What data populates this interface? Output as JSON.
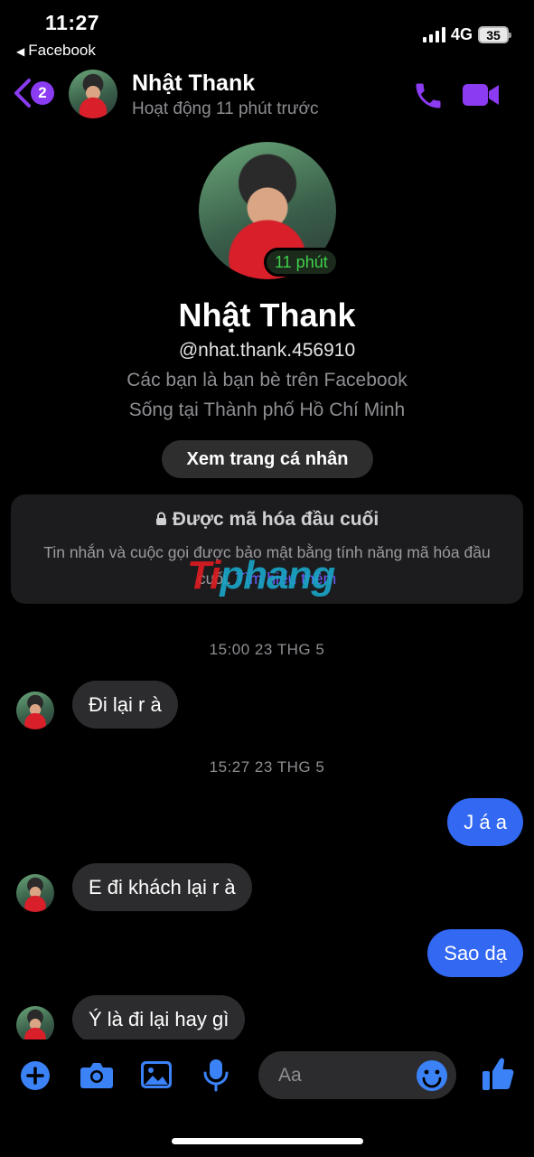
{
  "status_bar": {
    "time": "11:27",
    "back_app": "Facebook",
    "network": "4G",
    "battery": "35"
  },
  "header": {
    "unread_count": "2",
    "name": "Nhật Thank",
    "status": "Hoạt động 11 phút trước",
    "icons": [
      "back-chevron-icon",
      "phone-icon",
      "video-camera-icon"
    ],
    "accent_color": "#8b3cf2"
  },
  "profile": {
    "active_pill": "11 phút",
    "name": "Nhật Thank",
    "handle": "@nhat.thank.456910",
    "friends_line": "Các bạn là bạn bè trên Facebook",
    "location_line": "Sống tại Thành phố Hồ Chí Minh",
    "view_profile_label": "Xem trang cá nhân"
  },
  "encryption": {
    "title": "Được mã hóa đầu cuối",
    "body": "Tin nhắn và cuộc gọi được bảo mật bằng tính năng mã hóa đầu cuối.",
    "link": "Tìm hiểu thêm"
  },
  "watermark": {
    "part1": "Ti",
    "part2": "phang"
  },
  "messages": {
    "ts1": "15:00 23 THG 5",
    "m1": "Đi lại r à",
    "ts2": "15:27 23 THG 5",
    "m2": "J á a",
    "m3": "E đi khách lại r à",
    "m4": "Sao dạ",
    "m5": "Ý là đi lại hay gì",
    "outgoing_color": "#3268f2"
  },
  "composer": {
    "placeholder": "Aa",
    "icons": [
      "plus-icon",
      "camera-icon",
      "image-icon",
      "microphone-icon",
      "emoji-icon",
      "like-icon"
    ]
  }
}
